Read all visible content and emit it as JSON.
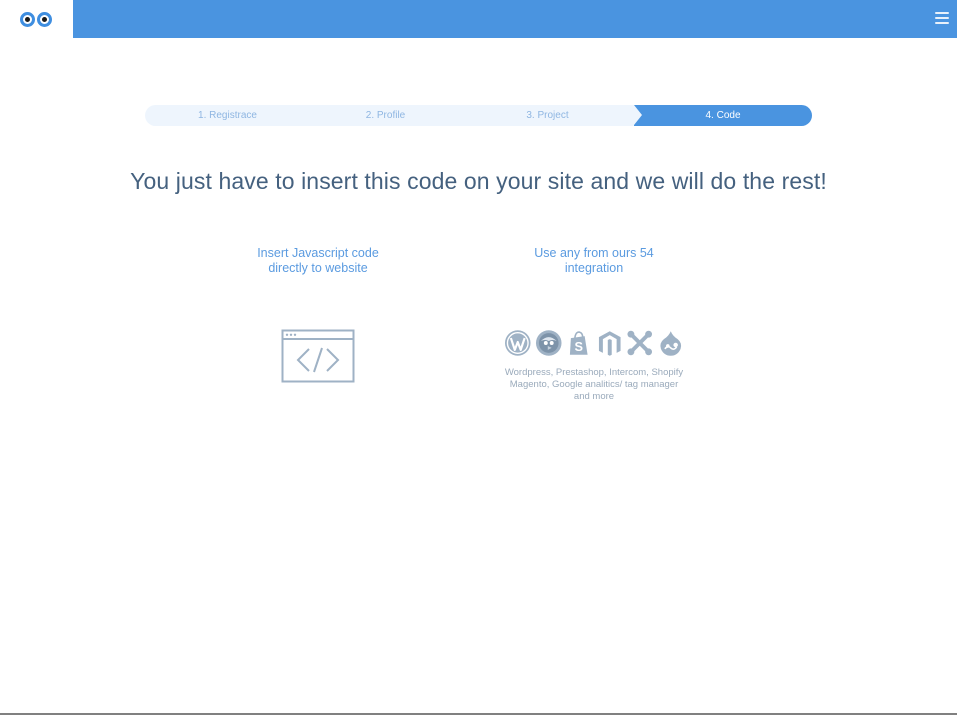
{
  "header": {
    "logo_icon": "owl-eyes-logo",
    "menu_icon": "hamburger-menu-icon",
    "brand_color": "#4a94e0"
  },
  "steps": [
    {
      "label": "1. Registrace",
      "active": false
    },
    {
      "label": "2. Profile",
      "active": false
    },
    {
      "label": "3. Project",
      "active": false
    },
    {
      "label": "4. Code",
      "active": true
    }
  ],
  "main": {
    "headline": "You just have to insert this code on your site and we will do the rest!",
    "options": [
      {
        "title_line1": "Insert Javascript code",
        "title_line2": "directly to website",
        "icon": "browser-code-icon"
      },
      {
        "title_line1": "Use any from ours 54",
        "title_line2": "integration",
        "icons": [
          "wordpress-icon",
          "prestashop-icon",
          "shopify-icon",
          "magento-icon",
          "joomla-icon",
          "drupal-icon"
        ],
        "desc_line1": "Wordpress, Prestashop, Intercom, Shopify",
        "desc_line2": "Magento, Google analitics/ tag manager",
        "desc_line3": "and more"
      }
    ]
  }
}
